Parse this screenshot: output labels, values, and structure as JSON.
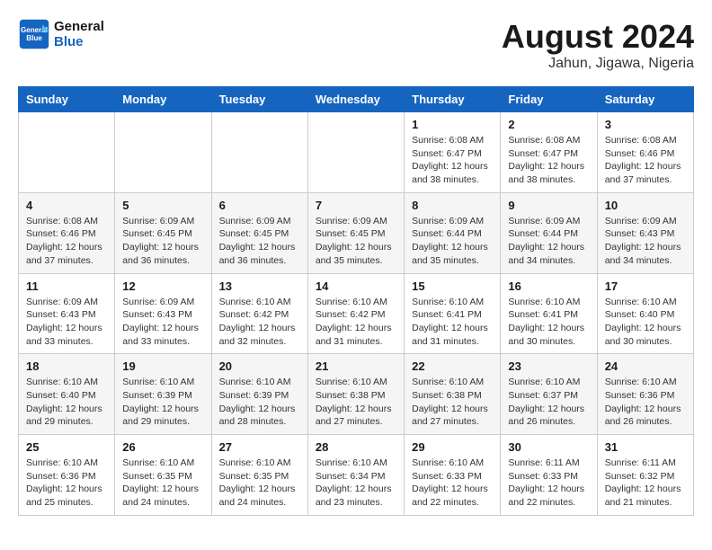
{
  "logo": {
    "line1": "General",
    "line2": "Blue"
  },
  "title": {
    "month_year": "August 2024",
    "location": "Jahun, Jigawa, Nigeria"
  },
  "days_of_week": [
    "Sunday",
    "Monday",
    "Tuesday",
    "Wednesday",
    "Thursday",
    "Friday",
    "Saturday"
  ],
  "weeks": [
    [
      {
        "day": "",
        "info": ""
      },
      {
        "day": "",
        "info": ""
      },
      {
        "day": "",
        "info": ""
      },
      {
        "day": "",
        "info": ""
      },
      {
        "day": "1",
        "info": "Sunrise: 6:08 AM\nSunset: 6:47 PM\nDaylight: 12 hours\nand 38 minutes."
      },
      {
        "day": "2",
        "info": "Sunrise: 6:08 AM\nSunset: 6:47 PM\nDaylight: 12 hours\nand 38 minutes."
      },
      {
        "day": "3",
        "info": "Sunrise: 6:08 AM\nSunset: 6:46 PM\nDaylight: 12 hours\nand 37 minutes."
      }
    ],
    [
      {
        "day": "4",
        "info": "Sunrise: 6:08 AM\nSunset: 6:46 PM\nDaylight: 12 hours\nand 37 minutes."
      },
      {
        "day": "5",
        "info": "Sunrise: 6:09 AM\nSunset: 6:45 PM\nDaylight: 12 hours\nand 36 minutes."
      },
      {
        "day": "6",
        "info": "Sunrise: 6:09 AM\nSunset: 6:45 PM\nDaylight: 12 hours\nand 36 minutes."
      },
      {
        "day": "7",
        "info": "Sunrise: 6:09 AM\nSunset: 6:45 PM\nDaylight: 12 hours\nand 35 minutes."
      },
      {
        "day": "8",
        "info": "Sunrise: 6:09 AM\nSunset: 6:44 PM\nDaylight: 12 hours\nand 35 minutes."
      },
      {
        "day": "9",
        "info": "Sunrise: 6:09 AM\nSunset: 6:44 PM\nDaylight: 12 hours\nand 34 minutes."
      },
      {
        "day": "10",
        "info": "Sunrise: 6:09 AM\nSunset: 6:43 PM\nDaylight: 12 hours\nand 34 minutes."
      }
    ],
    [
      {
        "day": "11",
        "info": "Sunrise: 6:09 AM\nSunset: 6:43 PM\nDaylight: 12 hours\nand 33 minutes."
      },
      {
        "day": "12",
        "info": "Sunrise: 6:09 AM\nSunset: 6:43 PM\nDaylight: 12 hours\nand 33 minutes."
      },
      {
        "day": "13",
        "info": "Sunrise: 6:10 AM\nSunset: 6:42 PM\nDaylight: 12 hours\nand 32 minutes."
      },
      {
        "day": "14",
        "info": "Sunrise: 6:10 AM\nSunset: 6:42 PM\nDaylight: 12 hours\nand 31 minutes."
      },
      {
        "day": "15",
        "info": "Sunrise: 6:10 AM\nSunset: 6:41 PM\nDaylight: 12 hours\nand 31 minutes."
      },
      {
        "day": "16",
        "info": "Sunrise: 6:10 AM\nSunset: 6:41 PM\nDaylight: 12 hours\nand 30 minutes."
      },
      {
        "day": "17",
        "info": "Sunrise: 6:10 AM\nSunset: 6:40 PM\nDaylight: 12 hours\nand 30 minutes."
      }
    ],
    [
      {
        "day": "18",
        "info": "Sunrise: 6:10 AM\nSunset: 6:40 PM\nDaylight: 12 hours\nand 29 minutes."
      },
      {
        "day": "19",
        "info": "Sunrise: 6:10 AM\nSunset: 6:39 PM\nDaylight: 12 hours\nand 29 minutes."
      },
      {
        "day": "20",
        "info": "Sunrise: 6:10 AM\nSunset: 6:39 PM\nDaylight: 12 hours\nand 28 minutes."
      },
      {
        "day": "21",
        "info": "Sunrise: 6:10 AM\nSunset: 6:38 PM\nDaylight: 12 hours\nand 27 minutes."
      },
      {
        "day": "22",
        "info": "Sunrise: 6:10 AM\nSunset: 6:38 PM\nDaylight: 12 hours\nand 27 minutes."
      },
      {
        "day": "23",
        "info": "Sunrise: 6:10 AM\nSunset: 6:37 PM\nDaylight: 12 hours\nand 26 minutes."
      },
      {
        "day": "24",
        "info": "Sunrise: 6:10 AM\nSunset: 6:36 PM\nDaylight: 12 hours\nand 26 minutes."
      }
    ],
    [
      {
        "day": "25",
        "info": "Sunrise: 6:10 AM\nSunset: 6:36 PM\nDaylight: 12 hours\nand 25 minutes."
      },
      {
        "day": "26",
        "info": "Sunrise: 6:10 AM\nSunset: 6:35 PM\nDaylight: 12 hours\nand 24 minutes."
      },
      {
        "day": "27",
        "info": "Sunrise: 6:10 AM\nSunset: 6:35 PM\nDaylight: 12 hours\nand 24 minutes."
      },
      {
        "day": "28",
        "info": "Sunrise: 6:10 AM\nSunset: 6:34 PM\nDaylight: 12 hours\nand 23 minutes."
      },
      {
        "day": "29",
        "info": "Sunrise: 6:10 AM\nSunset: 6:33 PM\nDaylight: 12 hours\nand 22 minutes."
      },
      {
        "day": "30",
        "info": "Sunrise: 6:11 AM\nSunset: 6:33 PM\nDaylight: 12 hours\nand 22 minutes."
      },
      {
        "day": "31",
        "info": "Sunrise: 6:11 AM\nSunset: 6:32 PM\nDaylight: 12 hours\nand 21 minutes."
      }
    ]
  ]
}
